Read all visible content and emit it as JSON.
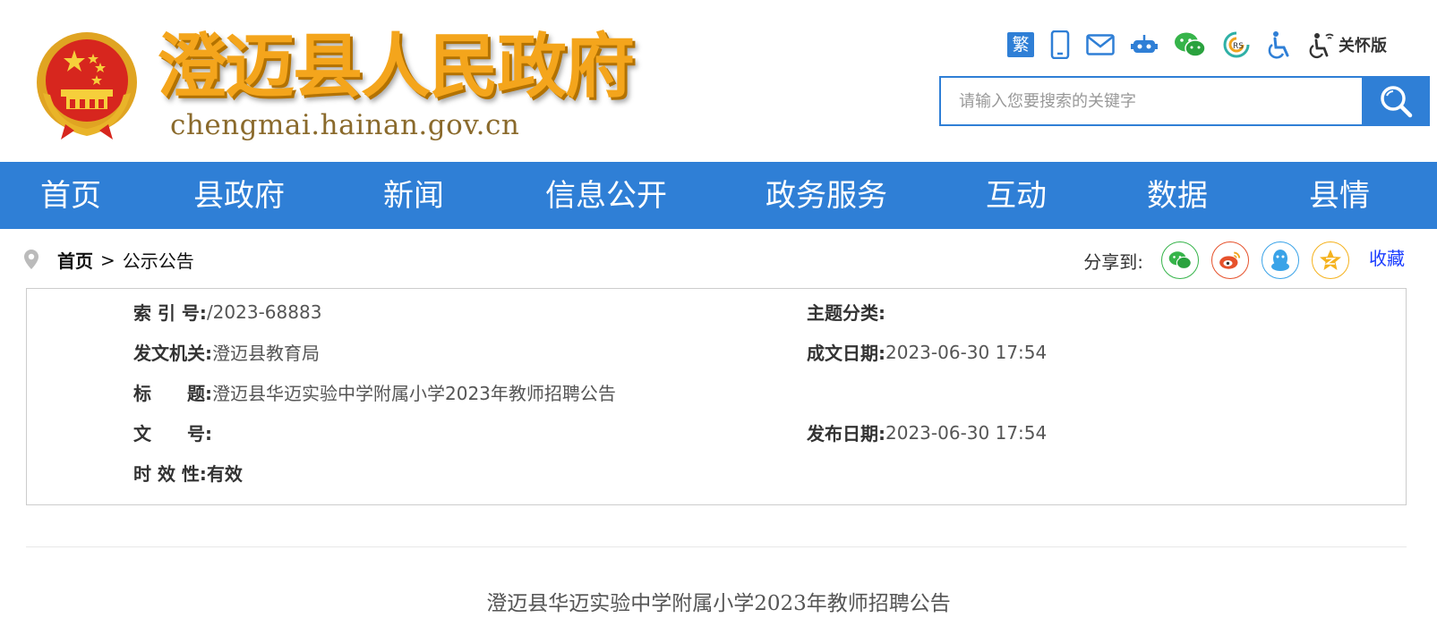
{
  "header": {
    "site_title": "澄迈县人民政府",
    "site_domain": "chengmai.hainan.gov.cn",
    "toolbar": {
      "traditional_label": "繁",
      "care_label": "关怀版"
    },
    "search": {
      "placeholder": "请输入您要搜索的关键字"
    }
  },
  "nav": {
    "items": [
      "首页",
      "县政府",
      "新闻",
      "信息公开",
      "政务服务",
      "互动",
      "数据",
      "县情"
    ]
  },
  "breadcrumb": {
    "home": "首页",
    "separator": ">",
    "current": "公示公告"
  },
  "share": {
    "label": "分享到:",
    "favorite": "收藏"
  },
  "meta": {
    "index_key": "索 引 号:",
    "index_val": "/2023-68883",
    "topic_key": "主题分类:",
    "topic_val": "",
    "issuer_key": "发文机关:",
    "issuer_val": "澄迈县教育局",
    "created_key": "成文日期:",
    "created_val": "2023-06-30 17:54",
    "title_key": "标　　题:",
    "title_val": "澄迈县华迈实验中学附属小学2023年教师招聘公告",
    "docno_key": "文　　号:",
    "docno_val": "",
    "published_key": "发布日期:",
    "published_val": "2023-06-30 17:54",
    "validity_key": "时 效 性:",
    "validity_val": "有效"
  },
  "article": {
    "title": "澄迈县华迈实验中学附属小学2023年教师招聘公告"
  },
  "colors": {
    "primary_blue": "#2f7fd6",
    "title_gold": "#f4a51c",
    "emblem_red": "#d7261e",
    "wechat_green": "#36b44a",
    "weibo_red": "#e6512b",
    "qq_blue": "#3aa3e8",
    "qzone_gold": "#f5b21d"
  }
}
